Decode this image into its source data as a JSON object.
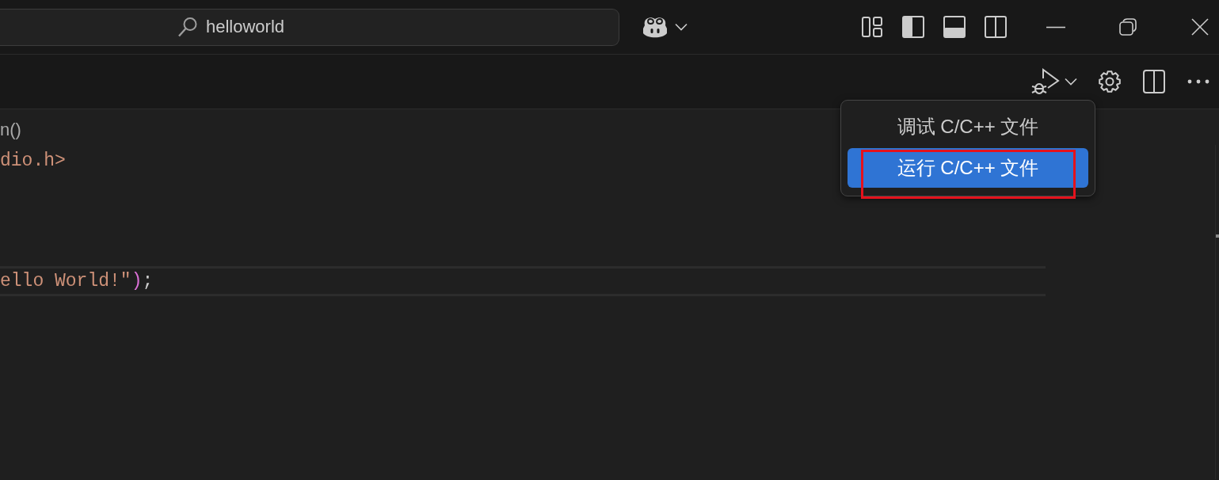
{
  "title_bar": {
    "search": {
      "label": "helloworld"
    }
  },
  "editor": {
    "breadcrumb": "n()",
    "lines": [
      {
        "current": false,
        "tokens": [
          {
            "kind": "string",
            "text": "dio.h>"
          }
        ]
      },
      {
        "current": false
      },
      {
        "current": false
      },
      {
        "current": false
      },
      {
        "current": true,
        "tokens": [
          {
            "kind": "string",
            "text": "ello World!\""
          },
          {
            "kind": "bracket",
            "text": ")"
          },
          {
            "kind": "punctuation",
            "text": ";"
          }
        ]
      },
      {
        "current": false
      }
    ]
  },
  "run_menu": {
    "items": [
      {
        "label": "调试 C/C++ 文件",
        "selected": false,
        "outlined": false
      },
      {
        "label": "运行 C/C++ 文件",
        "selected": true,
        "outlined": true
      }
    ]
  }
}
